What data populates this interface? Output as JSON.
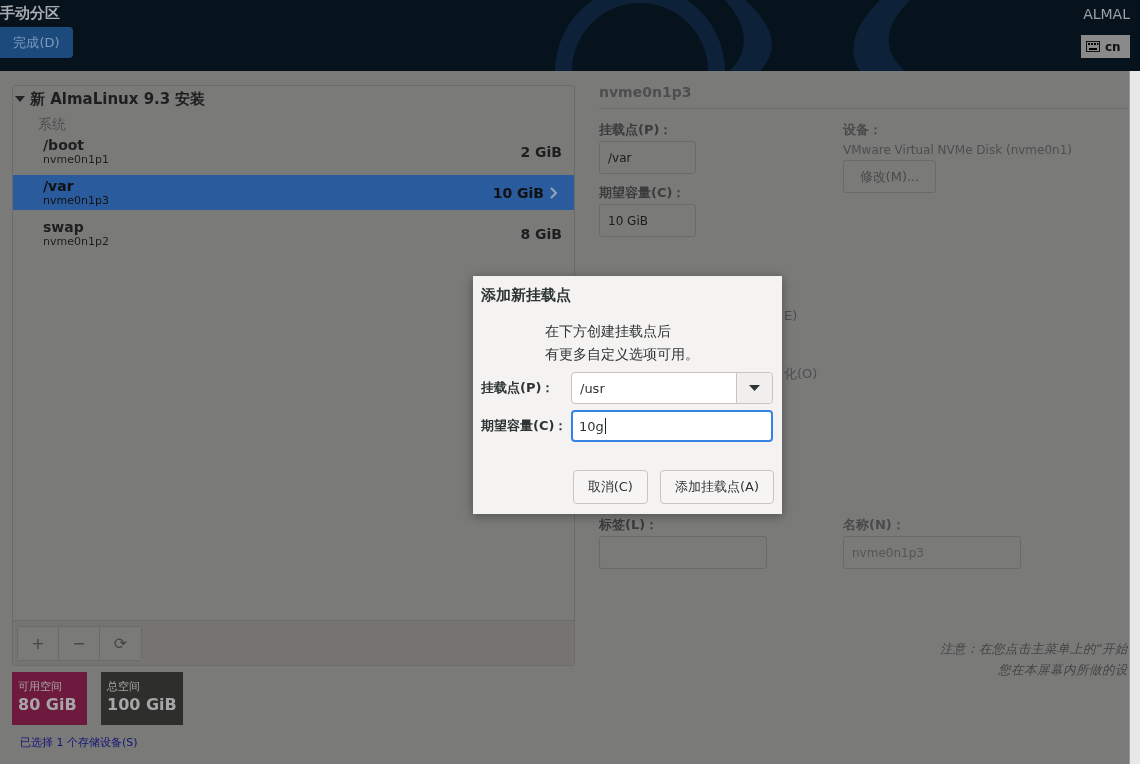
{
  "header": {
    "title": "手动分区",
    "done_button": "完成(D)",
    "product": "ALMAL",
    "keyboard": "cn"
  },
  "install": {
    "title": "新 AlmaLinux 9.3 安装",
    "expanded": true,
    "group": "系统",
    "partitions": [
      {
        "mount": "/boot",
        "device": "nvme0n1p1",
        "size": "2 GiB",
        "selected": false
      },
      {
        "mount": "/var",
        "device": "nvme0n1p3",
        "size": "10 GiB",
        "selected": true
      },
      {
        "mount": "swap",
        "device": "nvme0n1p2",
        "size": "8 GiB",
        "selected": false
      }
    ]
  },
  "toolbar": {
    "buttons": [
      "+",
      "−",
      "⟳"
    ]
  },
  "space": [
    {
      "label": "可用空间",
      "value": "80 GiB",
      "color": "#6e1a3e"
    },
    {
      "label": "总空间",
      "value": "100 GiB",
      "color": "#2e2e2c"
    }
  ],
  "storage_link": "已选择 1 个存储设备(S)",
  "detail": {
    "title": "nvme0n1p3",
    "mount_label": "挂载点(P)：",
    "mount_value": "/var",
    "size_label": "期望容量(C)：",
    "size_value": "10 GiB",
    "device_label": "设备：",
    "device_value": "VMware Virtual NVMe Disk (nvme0n1)",
    "modify_button": "修改(M)...",
    "partial_1": "E)",
    "partial_2": "化(O)",
    "tag_label": "标签(L)：",
    "name_label": "名称(N)：",
    "name_value": "nvme0n1p3",
    "note_lines": [
      "注意：在您点击主菜单上的“开始",
      "您在本屏幕内所做的设"
    ]
  },
  "dialog": {
    "title": "添加新挂载点",
    "message_lines": [
      "在下方创建挂载点后",
      "有更多自定义选项可用。"
    ],
    "mount_label": "挂载点(P)：",
    "mount_value": "/usr",
    "size_label": "期望容量(C)：",
    "size_value": "10g",
    "buttons": [
      "取消(C)",
      "添加挂载点(A)"
    ]
  }
}
